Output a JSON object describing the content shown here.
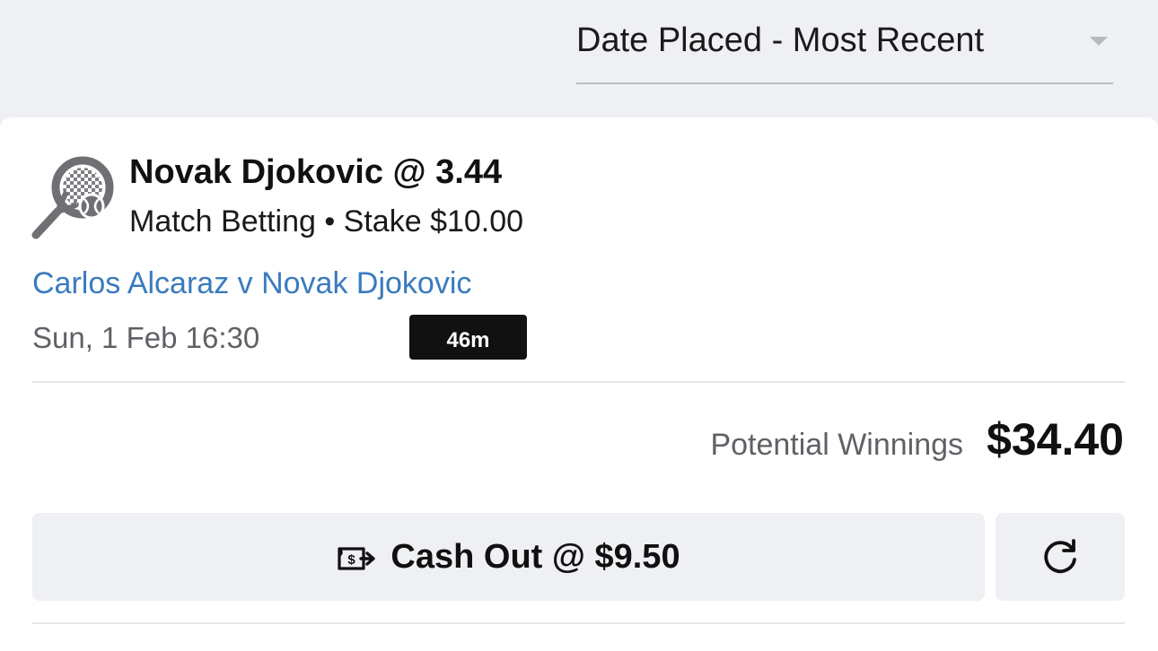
{
  "sort": {
    "selected": "Date Placed - Most Recent"
  },
  "bet": {
    "sport_icon": "tennis-racket-icon",
    "selection_title": "Novak Djokovic @ 3.44",
    "meta": "Match Betting • Stake $10.00",
    "event_name": "Carlos Alcaraz v Novak Djokovic",
    "event_time": "Sun, 1 Feb 16:30",
    "countdown": "46m",
    "potential_winnings_label": "Potential Winnings",
    "potential_winnings_value": "$34.40",
    "cashout_label": "Cash Out @ $9.50",
    "cashout_icon": "cash-out-icon",
    "refresh_icon": "refresh-icon"
  },
  "colors": {
    "page_background": "#eef0f3",
    "card_background": "#ffffff",
    "link": "#3a7bbf",
    "muted_text": "#5f6166",
    "badge_background": "#111111",
    "button_background": "#eef0f3"
  }
}
